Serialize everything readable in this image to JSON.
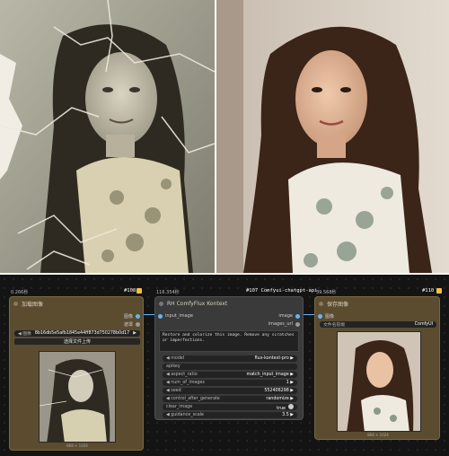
{
  "node_load": {
    "time": "0.266秒",
    "id": "#108",
    "title": "加载图像",
    "out_image": "图像",
    "out_mask": "遮罩",
    "file_label": "图像",
    "file_value": "8b16db5e5afb1845e44ff873d750278b0d17",
    "upload_label": "选择文件上传",
    "dims": "868 × 1024"
  },
  "node_flux": {
    "time": "116.354秒",
    "id": "#107 Comfyui-chatgpt-api",
    "title": "RH ComfyFlux Kontext",
    "in_image": "input_image",
    "out_image": "image",
    "out_url": "images_url",
    "prompt": "Restore and colorize this image. Remove any scratches or imperfections.",
    "params": [
      {
        "key": "model",
        "value": "flux-kontext-pro"
      },
      {
        "key": "apikey",
        "value": ""
      },
      {
        "key": "aspect_ratio",
        "value": "match_input_image"
      },
      {
        "key": "num_of_images",
        "value": "1"
      },
      {
        "key": "seed",
        "value": "552406298"
      },
      {
        "key": "control_after_generate",
        "value": "randomize"
      },
      {
        "key": "clear_image",
        "value": "true"
      },
      {
        "key": "guidance_scale",
        "value": "3.5"
      }
    ]
  },
  "node_save": {
    "time": "39.568秒",
    "id": "#110",
    "title": "保存图像",
    "in_image": "图像",
    "prefix_label": "文件名前缀",
    "prefix_value": "ComfyUI",
    "dims": "868 × 1024"
  },
  "colors": {
    "canvas": "#141414",
    "node_brown": "#5b4c30",
    "node_dark": "#3a3a3a",
    "link": "#64b5f6"
  }
}
